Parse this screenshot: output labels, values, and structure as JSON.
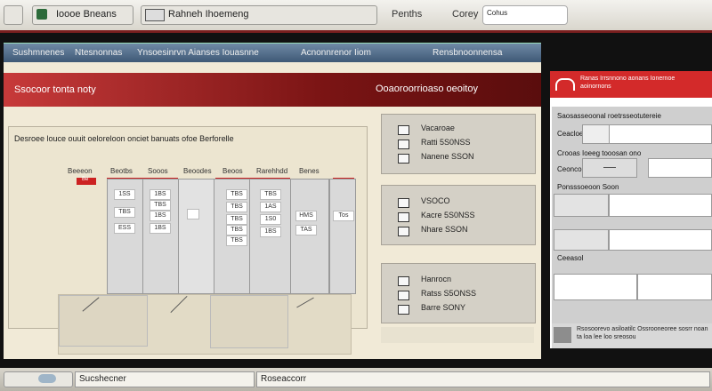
{
  "top": {
    "app_title": "Ioooe Bneans",
    "tab_title": "Rahneh Ihoemeng",
    "menu1": "Penths",
    "menu2": "Corey",
    "search_value": "Cohus"
  },
  "nav": {
    "items": [
      "Sushmnenes",
      "Ntesnonnas",
      "Ynsoesinrvn Aianses Iouasnne",
      "Acnonnrenor Iiom",
      "Rensbnoonnensa"
    ]
  },
  "main": {
    "header_left": "Ssocoor tonta noty",
    "header_right": "Ooaoroorrioaso oeoitoy",
    "panel_title": "Desroee louce ouuit oeloreloon onciet banuats ofoe Berforelle",
    "col_heads": [
      "Beeeon",
      "Beotbs",
      "Sooos",
      "Beoodes",
      "Beoos",
      "Rarehhdd",
      "Benes"
    ],
    "col_tab_mark": "Be",
    "col1_vals": [
      "1SS",
      "TBS",
      "ESS"
    ],
    "col2_vals": [
      "1BS",
      "TBS",
      "1BS",
      "1BS"
    ],
    "col3_vals": [
      "TBS",
      "TBS",
      "TBS",
      "TBS",
      "TBS"
    ],
    "col4_vals": [
      "TBS",
      "1AS",
      "1S0",
      "1BS"
    ],
    "col5_vals": [
      "HMS",
      "TAS"
    ],
    "col_extra": "Tos"
  },
  "cards": [
    {
      "lines": [
        "Vacaroae",
        "Ratti 5S0NSS",
        "Nanene SSON"
      ]
    },
    {
      "lines": [
        "VSOCO",
        "Kacre 5S0NSS",
        "Nhare SSON"
      ]
    },
    {
      "lines": [
        "Hanrocn",
        "Ratss S5ONSS",
        "Barre SONY"
      ]
    }
  ],
  "right": {
    "header_text": "Ranas Irrsnnono aonans Ionernoe aoinornons",
    "rows": [
      {
        "label": "Saosasseoonal roetrsseotutereie"
      },
      {
        "label": "Ceacloe"
      },
      {
        "label": "Crooas Ioeeg tooosan ono"
      },
      {
        "label": "Ceoncon"
      },
      {
        "label": "Ponsssoeoon Soon"
      },
      {
        "label": "Ceeasol"
      }
    ],
    "footer_text": "Rsosoorevo asiloatilc Ossrooneoree sosrr noan ta loa lee loo sreosou"
  },
  "bottom": {
    "label1": "Sucshecner",
    "label2": "Roseaccorr"
  }
}
